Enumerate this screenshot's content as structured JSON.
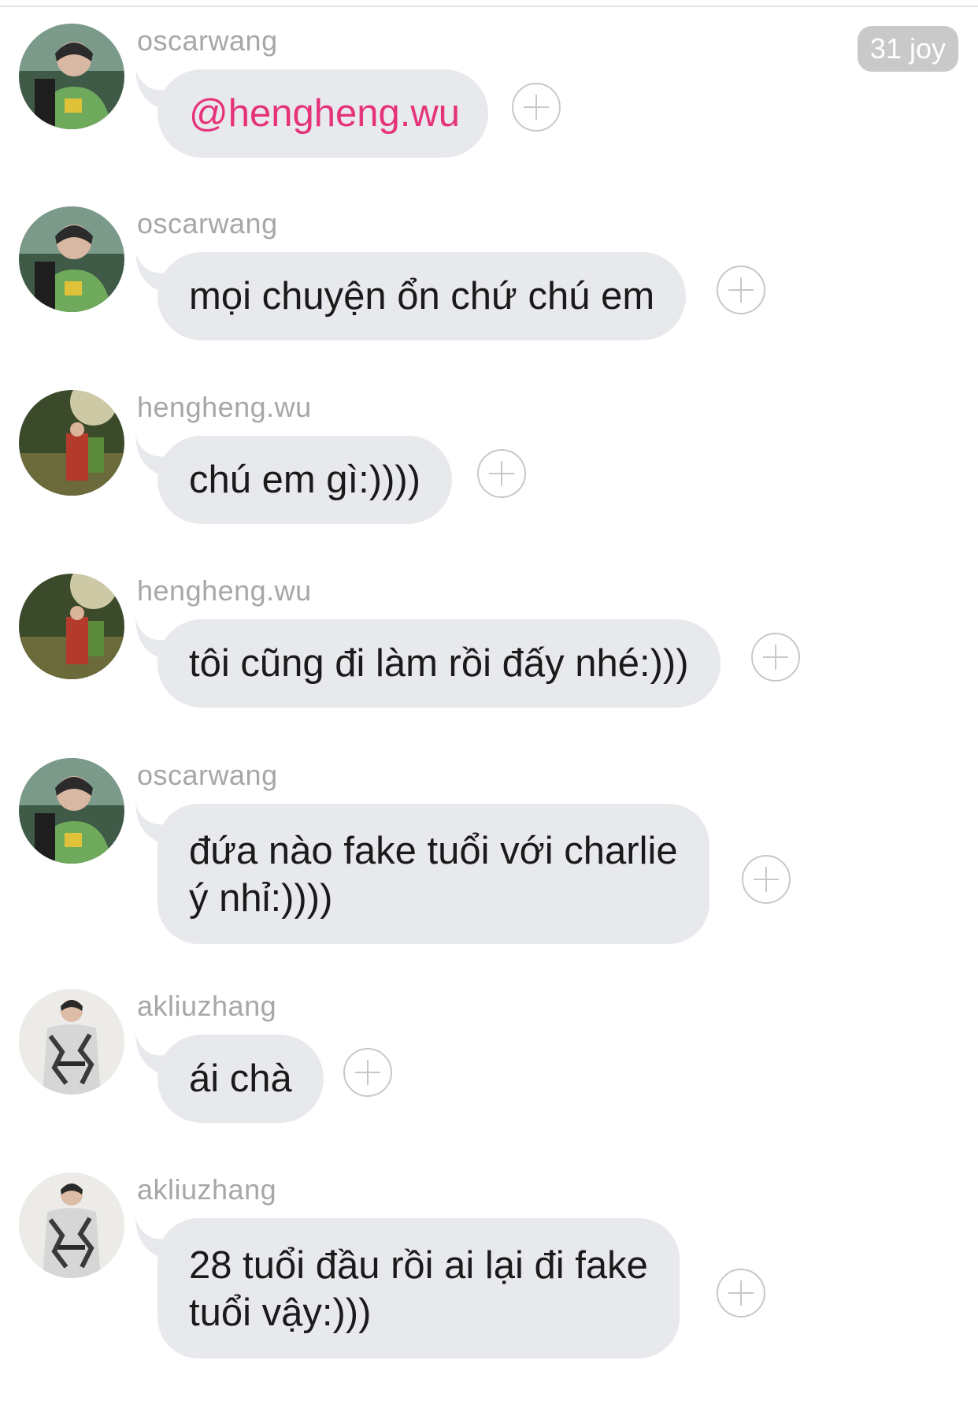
{
  "header": {
    "badge_text": "31 joy"
  },
  "messages": [
    {
      "username": "oscarwang",
      "avatar": "oscarwang-avatar",
      "text": "@hengheng.wu",
      "is_mention": true
    },
    {
      "username": "oscarwang",
      "avatar": "oscarwang-avatar",
      "text": "mọi chuyện ổn chứ chú em"
    },
    {
      "username": "hengheng.wu",
      "avatar": "hengheng-avatar",
      "text": "chú em gì:))))"
    },
    {
      "username": "hengheng.wu",
      "avatar": "hengheng-avatar",
      "text": "tôi cũng đi làm rồi đấy nhé:)))"
    },
    {
      "username": "oscarwang",
      "avatar": "oscarwang-avatar",
      "text_lines": [
        "đứa nào fake tuổi với charlie",
        "ý nhỉ:))))"
      ]
    },
    {
      "username": "akliuzhang",
      "avatar": "akliuzhang-avatar",
      "text": "ái chà"
    },
    {
      "username": "akliuzhang",
      "avatar": "akliuzhang-avatar",
      "text_lines": [
        "28 tuổi đầu rồi ai lại đi fake",
        "tuổi vậy:)))"
      ]
    }
  ],
  "colors": {
    "bubble": "#e8e9ec",
    "username": "#a7a7ab",
    "mention": "#e5337a",
    "badge": "#c9c9c9",
    "plus_icon": "#c8c8cc"
  },
  "icons": {
    "react": "plus-circle-icon"
  }
}
